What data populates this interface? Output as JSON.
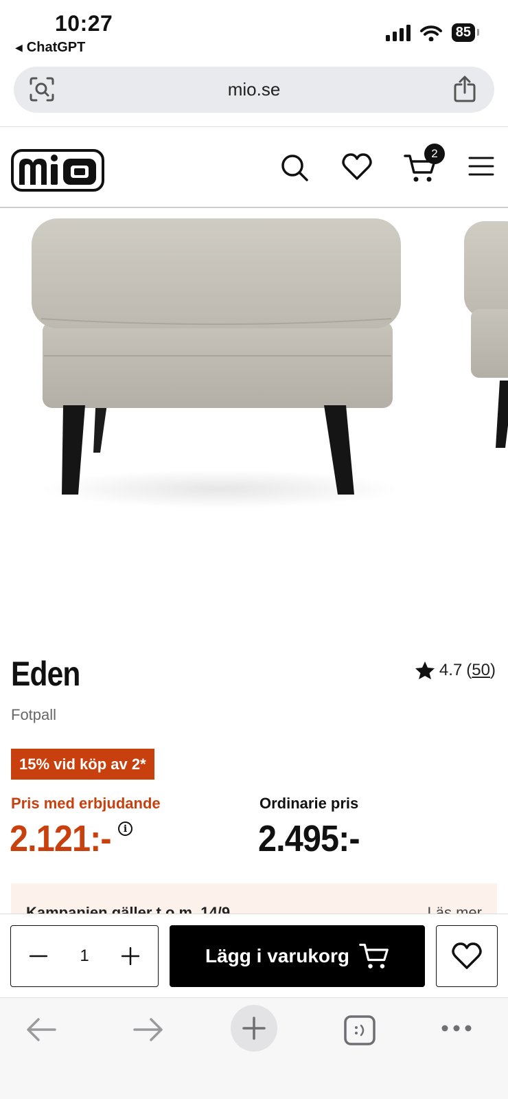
{
  "status_bar": {
    "time": "10:27",
    "back_app": "ChatGPT",
    "battery": "85"
  },
  "browser": {
    "url": "mio.se"
  },
  "site": {
    "logo_text": "mio",
    "cart_count": "2"
  },
  "product": {
    "name": "Eden",
    "subtitle": "Fotpall",
    "rating": "4.7",
    "review_count": "50",
    "promo_badge": "15% vid köp av 2*",
    "offer_label": "Pris med erbjudande",
    "offer_price": "2.121:-",
    "regular_label": "Ordinarie pris",
    "regular_price": "2.495:-",
    "info_icon_label": "i"
  },
  "campaign": {
    "text": "Kampanjen gäller t.o.m. 14/9",
    "more": "Läs mer"
  },
  "cart_bar": {
    "quantity": "1",
    "add_to_cart_label": "Lägg i varukorg"
  },
  "icons": {
    "status": [
      "signal-icon",
      "wifi-icon",
      "battery-icon"
    ],
    "header": [
      "search-icon",
      "heart-icon",
      "cart-icon",
      "menu-icon"
    ],
    "toolbar": [
      "back-arrow-icon",
      "forward-arrow-icon",
      "plus-icon",
      "tabs-icon",
      "more-icon"
    ]
  },
  "colors": {
    "accent": "#c9400f",
    "campaign_bg": "#fdf1ec",
    "button_bg": "#000000"
  }
}
